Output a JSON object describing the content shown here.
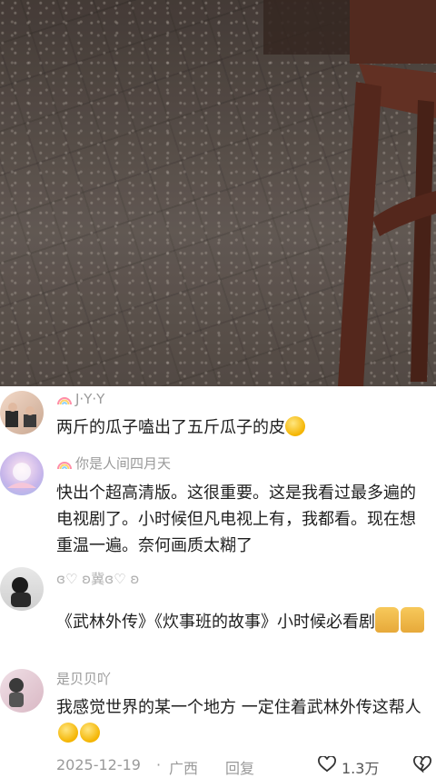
{
  "comments": [
    {
      "username": "J·Y·Y",
      "text": "两斤的瓜子嗑出了五斤瓜子的皮",
      "emoji": "smirk-emoji"
    },
    {
      "username": "你是人间四月天",
      "text": "快出个超高清版。这很重要。这是我看过最多遍的电视剧了。小时候但凡电视上有，我都看。现在想重温一遍。奈何画质太糊了"
    },
    {
      "username": "ɞ♡ ʚ冀ɞ♡ ʚ",
      "text": "《武林外传》《炊事班的故事》小时候必看剧",
      "emoji": "cat-emoji"
    },
    {
      "username": "是贝贝吖",
      "text": "我感觉世界的某一个地方 一定住着武林外传这帮人",
      "emoji": "crying-emoji"
    }
  ],
  "footer": {
    "date": "2025-12-19",
    "separator": "·",
    "location": "广西",
    "reply_label": "回复",
    "like_count": "1.3万"
  }
}
